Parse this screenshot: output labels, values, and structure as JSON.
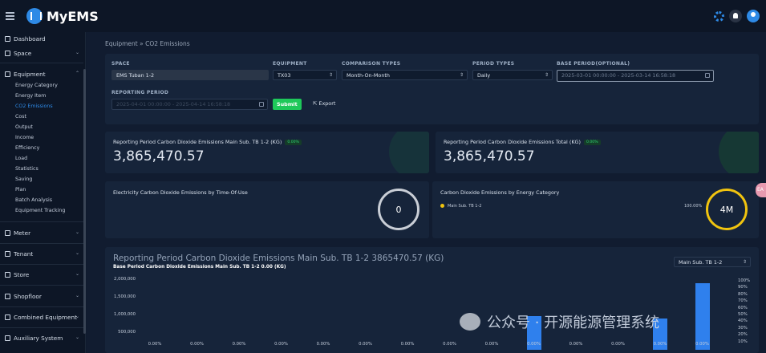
{
  "app": {
    "brand": "MyEMS"
  },
  "sidebar": {
    "items": [
      {
        "label": "Dashboard",
        "icon": "dashboard-icon"
      },
      {
        "label": "Space",
        "icon": "building-icon"
      },
      {
        "label": "Equipment",
        "icon": "user-icon"
      },
      {
        "label": "Meter",
        "icon": "gauge-icon"
      },
      {
        "label": "Tenant",
        "icon": "user-icon"
      },
      {
        "label": "Store",
        "icon": "store-icon"
      },
      {
        "label": "Shopfloor",
        "icon": "factory-icon"
      },
      {
        "label": "Combined Equipment",
        "icon": "gears-icon"
      },
      {
        "label": "Auxiliary System",
        "icon": "monitor-icon"
      }
    ],
    "equipment_sub": [
      "Energy Category",
      "Energy Item",
      "CO2 Emissions",
      "Cost",
      "Output",
      "Income",
      "Efficiency",
      "Load",
      "Statistics",
      "Saving",
      "Plan",
      "Batch Analysis",
      "Equipment Tracking"
    ],
    "active_sub": "CO2 Emissions"
  },
  "breadcrumb": {
    "parent": "Equipment",
    "sep": "»",
    "current": "CO2 Emissions"
  },
  "filters": {
    "space_label": "SPACE",
    "space_value": "EMS Tuban 1-2",
    "equipment_label": "EQUIPMENT",
    "equipment_value": "TX03",
    "comparison_label": "COMPARISON TYPES",
    "comparison_value": "Month-On-Month",
    "period_label": "PERIOD TYPES",
    "period_value": "Daily",
    "base_label": "BASE PERIOD(OPTIONAL)",
    "base_value": "2025-03-01 00:00:00 - 2025-03-14 16:58:18",
    "reporting_label": "REPORTING PERIOD",
    "reporting_value": "2025-04-01 00:00:00 - 2025-04-14 16:58:18",
    "submit": "Submit",
    "export": "Export"
  },
  "cards": {
    "c1_title": "Reporting Period Carbon Dioxide Emissions Main Sub. TB 1-2 (KG)",
    "c1_pct": "0.00%",
    "c1_value": "3,865,470.57",
    "c2_title": "Reporting Period Carbon Dioxide Emissions Total (KG)",
    "c2_pct": "0.00%",
    "c2_value": "3,865,470.57",
    "c3_title": "Electricity Carbon Dioxide Emissions by Time-Of-Use",
    "c3_ring": "0",
    "c4_title": "Carbon Dioxide Emissions by Energy Category",
    "c4_legend": "Main Sub. TB 1-2",
    "c4_pct": "100.00%",
    "c4_ring": "4M"
  },
  "chart_panel": {
    "title": "Reporting Period Carbon Dioxide Emissions Main Sub. TB 1-2 3865470.57 (KG)",
    "subtitle": "Base Period Carbon Dioxide Emissions Main Sub. TB 1-2 0.00 (KG)",
    "select": "Main Sub. TB 1-2"
  },
  "chart_data": {
    "type": "bar",
    "y_ticks": [
      "2,000,000",
      "1,500,000",
      "1,000,000",
      "500,000"
    ],
    "right_ticks": [
      "100%",
      "90%",
      "80%",
      "70%",
      "60%",
      "50%",
      "40%",
      "30%",
      "20%",
      "10%"
    ],
    "data_labels": [
      "0.00%",
      "0.00%",
      "0.00%",
      "0.00%",
      "0.00%",
      "0.00%",
      "0.00%",
      "0.00%",
      "0.00%",
      "0.00%",
      "0.00%",
      "0.00%",
      "0.00%",
      "0.00%"
    ],
    "values": [
      0,
      0,
      0,
      0,
      0,
      0,
      0,
      0,
      0,
      950000,
      0,
      0,
      880000,
      1880000
    ],
    "ylim": [
      0,
      2000000
    ]
  },
  "watermark": "公众号 · 开源能源管理系统",
  "side_tab": "EA"
}
